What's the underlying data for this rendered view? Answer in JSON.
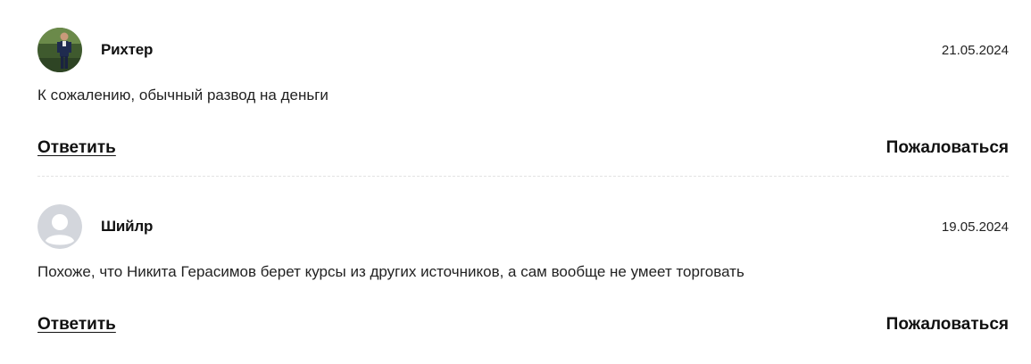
{
  "comments": [
    {
      "author": "Рихтер",
      "date": "21.05.2024",
      "text": "К сожалению, обычный развод на деньги",
      "avatar": "photo-avatar",
      "reply_label": "Ответить",
      "report_label": "Пожаловаться"
    },
    {
      "author": "Шийлр",
      "date": "19.05.2024",
      "text": "Похоже, что Никита Герасимов берет курсы из других источников, а сам вообще не умеет торговать",
      "avatar": "default-user-avatar",
      "reply_label": "Ответить",
      "report_label": "Пожаловаться"
    }
  ],
  "colors": {
    "text": "#1a1a1a",
    "divider": "#e2e2e2",
    "default_avatar_bg": "#d3d6dc",
    "default_avatar_fg": "#ffffff"
  }
}
